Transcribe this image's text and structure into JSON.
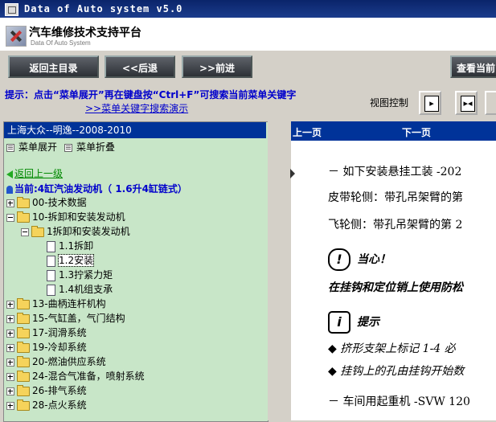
{
  "window": {
    "title": "Data of Auto system v5.0"
  },
  "header": {
    "title": "汽车维修技术支持平台",
    "subtitle": "Data Of Auto System"
  },
  "toolbar": {
    "back_main": "返回主目录",
    "back": "<<后退",
    "forward": ">>前进",
    "view_current": "查看当前"
  },
  "hint": {
    "text": "提示：点击“菜单展开”再在键盘按“Ctrl+F”可搜索当前菜单关键字",
    "link": ">>菜单关键字搜索演示"
  },
  "view_control": {
    "label": "视图控制"
  },
  "sidebar": {
    "header": "上海大众--明逸--2008-2010",
    "expand": "菜单展开",
    "collapse": "菜单折叠",
    "back_level": "返回上一级",
    "current": "当前:4缸汽油发动机（ 1.6升4缸链式）",
    "tree": [
      "00-技术数据",
      "10-拆卸和安装发动机",
      "1拆卸和安装发动机",
      "1.1拆卸",
      "1.2安装",
      "1.3拧紧力矩",
      "1.4机组支承",
      "13-曲柄连杆机构",
      "15-气缸盖，气门结构",
      "17-润滑系统",
      "19-冷却系统",
      "20-燃油供应系统",
      "24-混合气准备，喷射系统",
      "26-排气系统",
      "28-点火系统"
    ]
  },
  "content": {
    "prev": "上一页",
    "next": "下一页",
    "line1": "－ 如下安装悬挂工装 -202",
    "line2": "皮带轮侧：带孔吊架臂的第",
    "line3": "飞轮侧：带孔吊架臂的第 2",
    "caution": "当心！",
    "caution_text": "在挂钩和定位销上使用防松",
    "note": "提示",
    "bullet1": "◆  挤形支架上标记 1-4 必",
    "bullet2": "◆  挂钩上的孔由挂钩开始数",
    "line4": "－ 车间用起重机 -SVW 120"
  }
}
